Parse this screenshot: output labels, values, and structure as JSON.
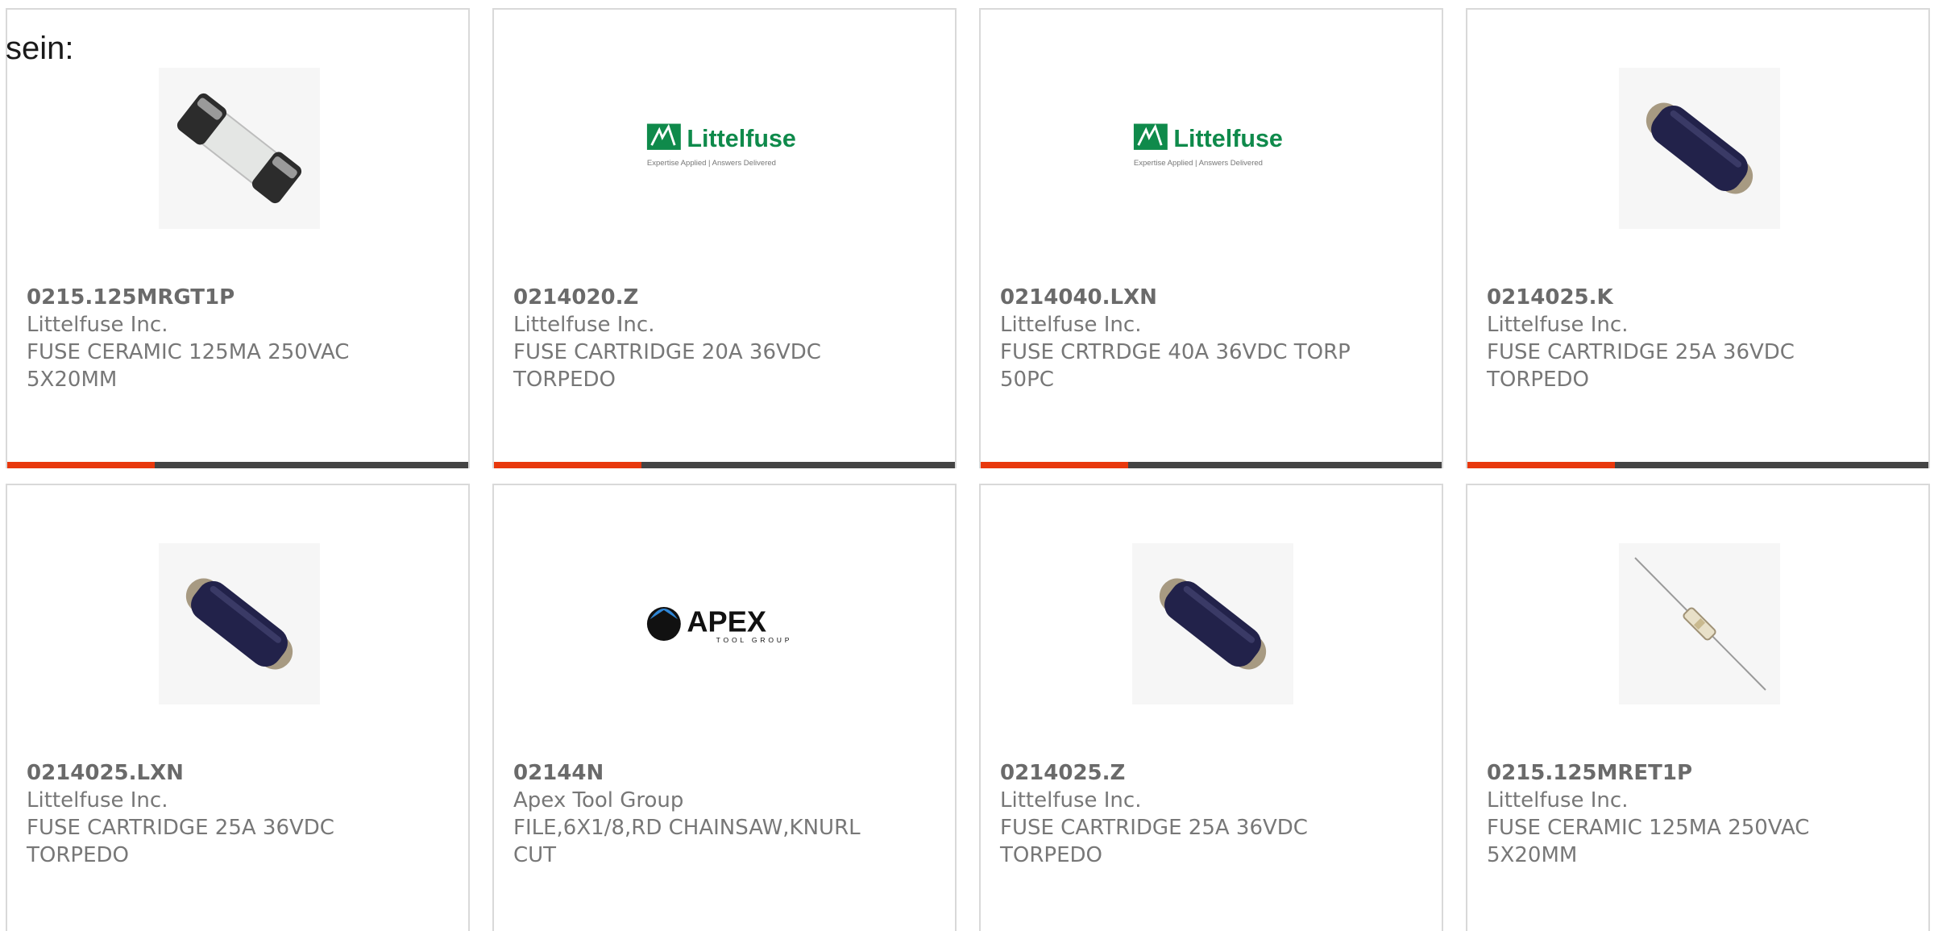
{
  "intro_text": "sein:",
  "colors": {
    "accent": "#e8380d",
    "bar_base": "#444444",
    "littelfuse_green": "#0f8a4b"
  },
  "logos": {
    "littelfuse_word": "Littelfuse",
    "littelfuse_tagline": "Expertise Applied | Answers Delivered",
    "apex_word": "APEX",
    "apex_sub": "TOOL GROUP"
  },
  "products": [
    {
      "part": "0215.125MRGT1P",
      "maker": "Littelfuse Inc.",
      "desc1": "FUSE CERAMIC 125MA 250VAC",
      "desc2": "5X20MM",
      "image": "ceramic-fuse-icon"
    },
    {
      "part": "0214020.Z",
      "maker": "Littelfuse Inc.",
      "desc1": "FUSE CARTRIDGE 20A 36VDC",
      "desc2": "TORPEDO",
      "image": "littelfuse-logo"
    },
    {
      "part": "0214040.LXN",
      "maker": "Littelfuse Inc.",
      "desc1": "FUSE CRTRDGE 40A 36VDC TORP",
      "desc2": "50PC",
      "image": "littelfuse-logo"
    },
    {
      "part": "0214025.K",
      "maker": "Littelfuse Inc.",
      "desc1": "FUSE CARTRIDGE 25A 36VDC",
      "desc2": "TORPEDO",
      "image": "torpedo-fuse-icon"
    },
    {
      "part": "0214025.LXN",
      "maker": "Littelfuse Inc.",
      "desc1": "FUSE CARTRIDGE 25A 36VDC",
      "desc2": "TORPEDO",
      "image": "torpedo-fuse-icon"
    },
    {
      "part": "02144N",
      "maker": "Apex Tool Group",
      "desc1": "FILE,6X1/8,RD CHAINSAW,KNURL",
      "desc2": "CUT",
      "image": "apex-logo"
    },
    {
      "part": "0214025.Z",
      "maker": "Littelfuse Inc.",
      "desc1": "FUSE CARTRIDGE 25A 36VDC",
      "desc2": "TORPEDO",
      "image": "torpedo-fuse-icon"
    },
    {
      "part": "0215.125MRET1P",
      "maker": "Littelfuse Inc.",
      "desc1": "FUSE CERAMIC 125MA 250VAC",
      "desc2": "5X20MM",
      "image": "axial-fuse-icon"
    }
  ]
}
